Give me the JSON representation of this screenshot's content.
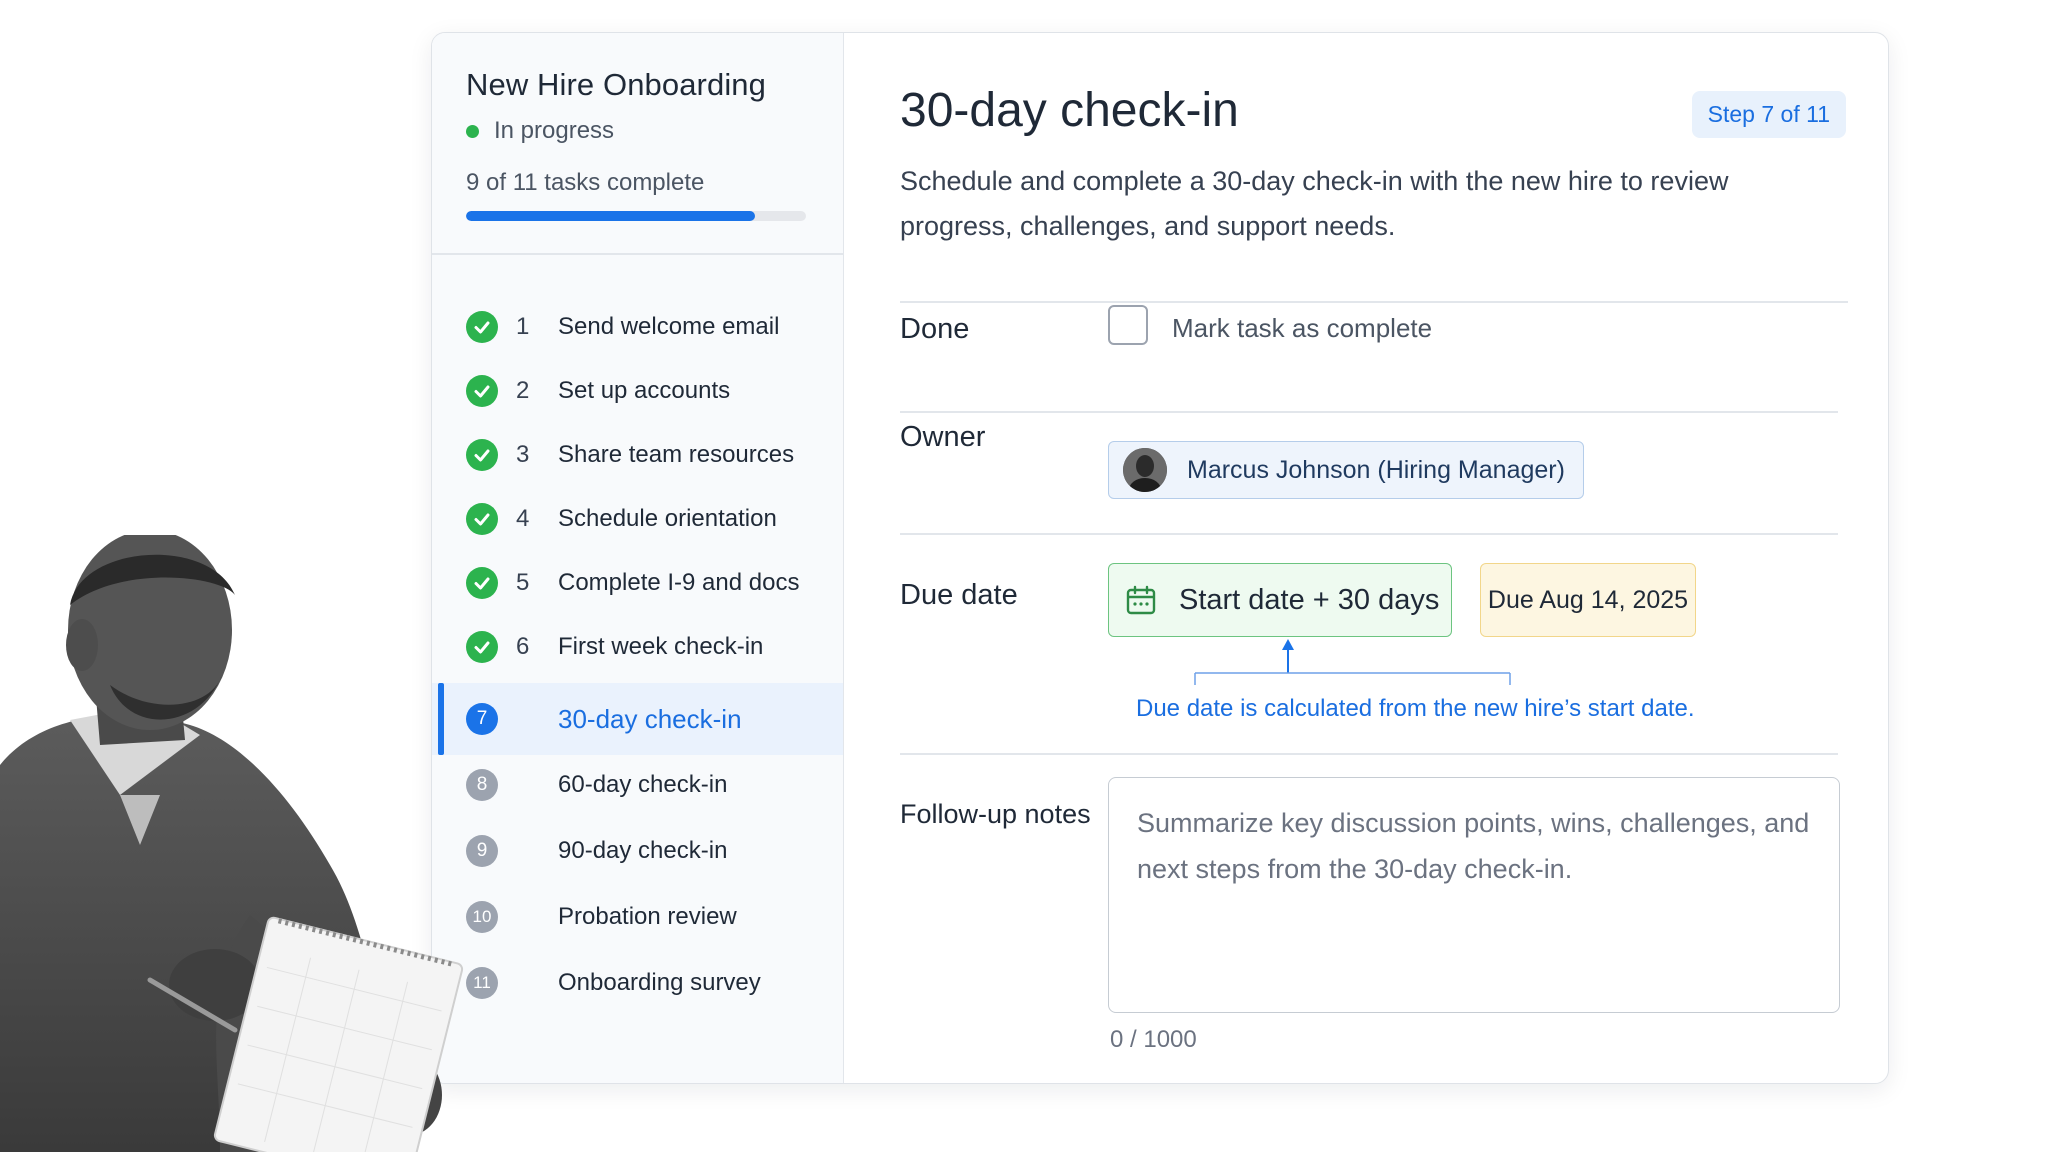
{
  "sidebar": {
    "title": "New Hire Onboarding",
    "status": "In progress",
    "status_color": "#2cb34e",
    "tasks_summary": "9 of 11 tasks complete",
    "progress_fraction": 0.85,
    "accent": "#1a73e8",
    "steps": [
      {
        "num": "1",
        "label": "Send welcome email",
        "state": "done"
      },
      {
        "num": "2",
        "label": "Set up accounts",
        "state": "done"
      },
      {
        "num": "3",
        "label": "Share team resources",
        "state": "done"
      },
      {
        "num": "4",
        "label": "Schedule orientation",
        "state": "done"
      },
      {
        "num": "5",
        "label": "Complete I-9 and docs",
        "state": "done"
      },
      {
        "num": "6",
        "label": "First week check-in",
        "state": "done"
      },
      {
        "num": "7",
        "label": "30-day check-in",
        "state": "active"
      },
      {
        "num": "8",
        "label": "60-day check-in",
        "state": "pending"
      },
      {
        "num": "9",
        "label": "90-day check-in",
        "state": "pending"
      },
      {
        "num": "10",
        "label": "Probation review",
        "state": "pending"
      },
      {
        "num": "11",
        "label": "Onboarding survey",
        "state": "pending"
      }
    ]
  },
  "main": {
    "title": "30-day check-in",
    "step_badge": "Step 7 of 11",
    "description": "Schedule and complete a 30-day check-in with the new hire to review progress, challenges, and support needs.",
    "done": {
      "label": "Done",
      "checkbox_label": "Mark task as complete",
      "checked": false
    },
    "owner": {
      "label": "Owner",
      "name": "Marcus Johnson (Hiring Manager)"
    },
    "due_date": {
      "label": "Due date",
      "formula": "Start date + 30 days",
      "due": "Due Aug 14, 2025",
      "hint": "Due date is calculated from the new hire’s start date."
    },
    "notes": {
      "label": "Follow-up notes",
      "placeholder": "Summarize key discussion points, wins, challenges, and next steps from the 30-day check-in.",
      "counter": "0 / 1000"
    }
  }
}
